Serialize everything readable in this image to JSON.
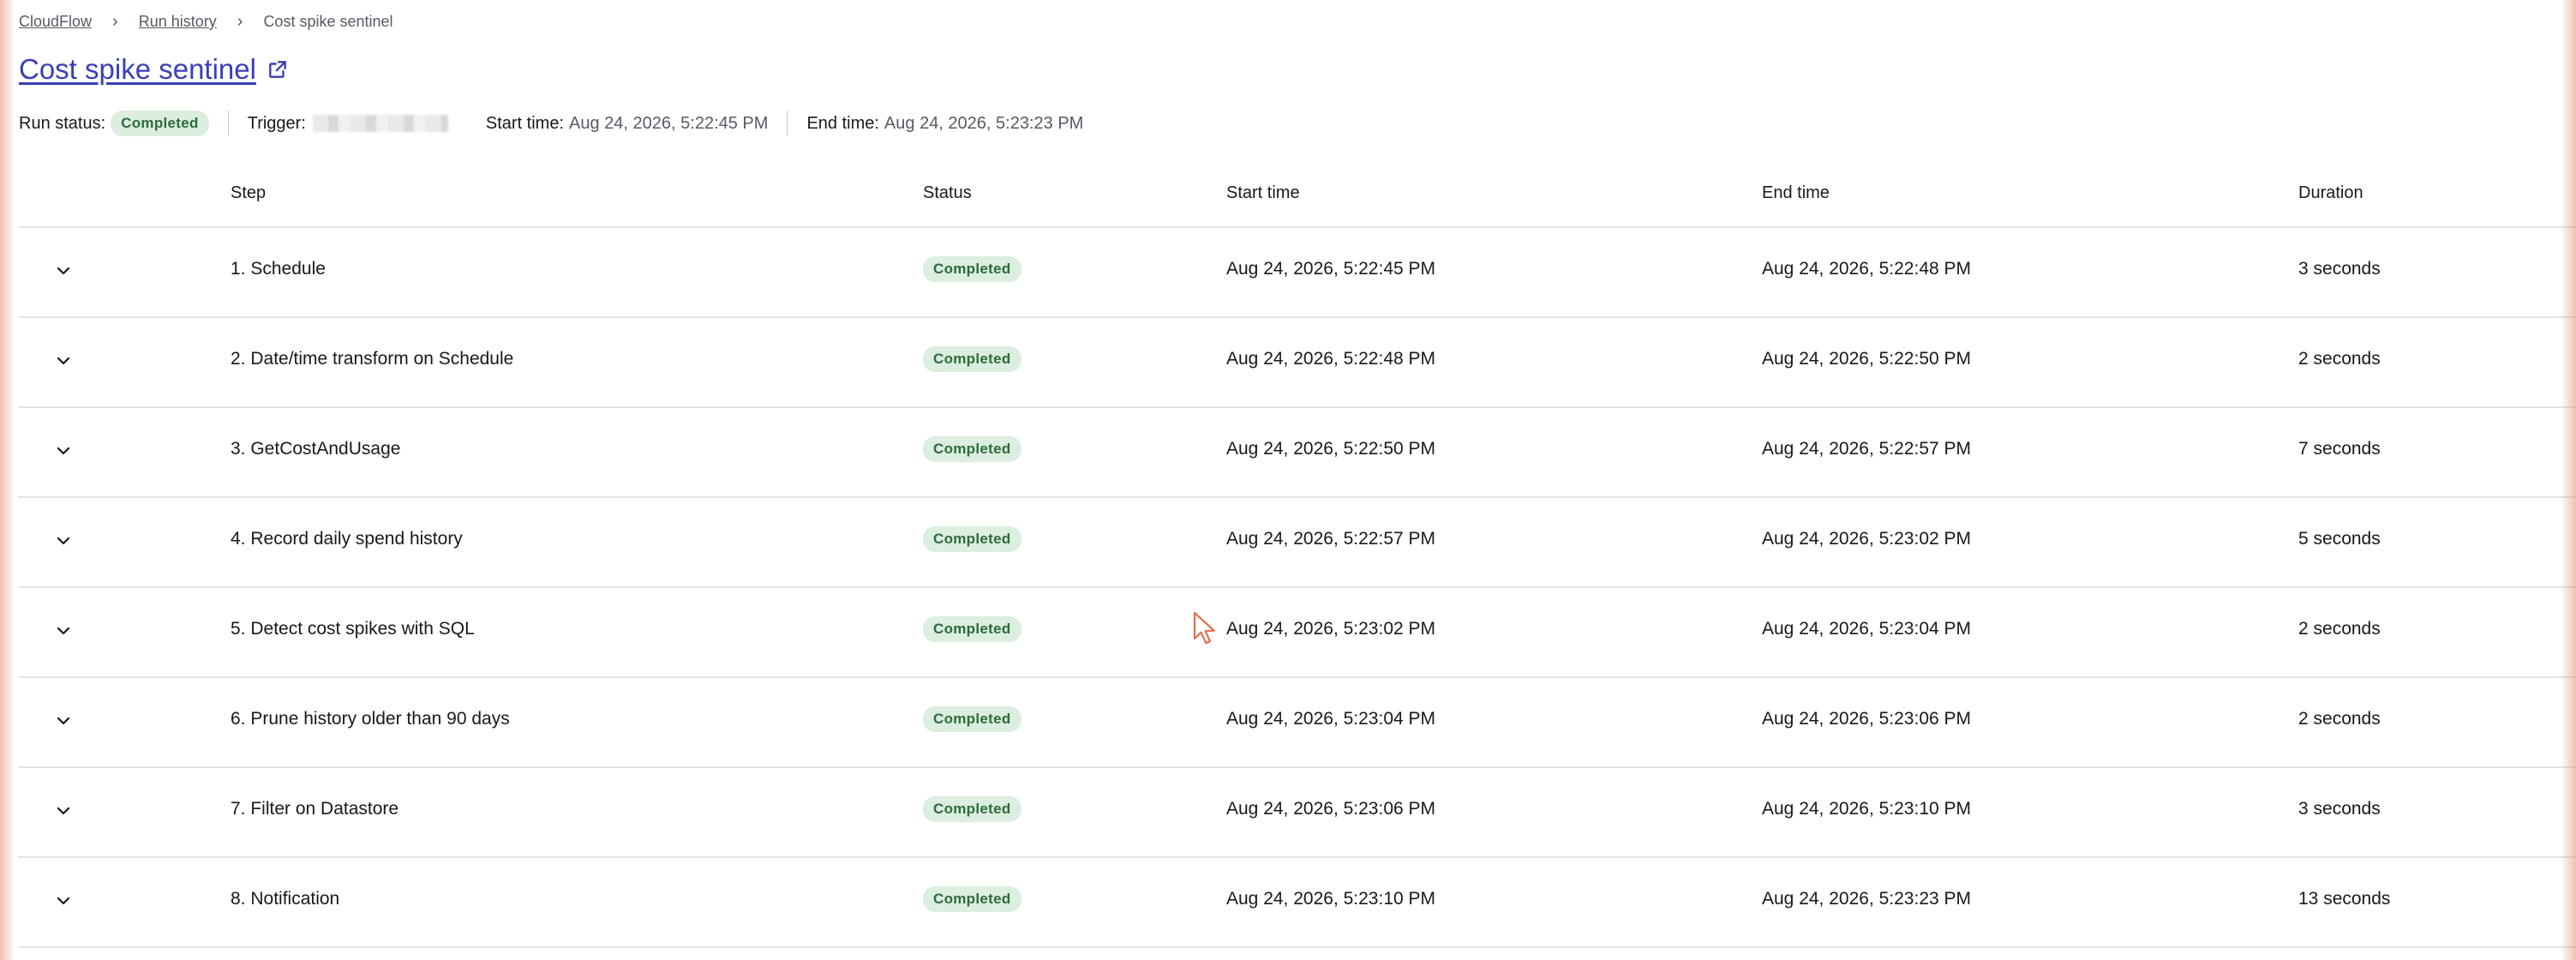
{
  "breadcrumb": {
    "items": [
      "CloudFlow",
      "Run history",
      "Cost spike sentinel"
    ]
  },
  "title": "Cost spike sentinel",
  "meta": {
    "run_status_label": "Run status:",
    "run_status_value": "Completed",
    "trigger_label": "Trigger:",
    "start_time_label": "Start time:",
    "start_time_value": "Aug 24, 2026, 5:22:45 PM",
    "end_time_label": "End time:",
    "end_time_value": "Aug 24, 2026, 5:23:23 PM"
  },
  "table": {
    "headers": {
      "step": "Step",
      "status": "Status",
      "start": "Start time",
      "end": "End time",
      "duration": "Duration"
    },
    "rows": [
      {
        "step": "1. Schedule",
        "status": "Completed",
        "start": "Aug 24, 2026, 5:22:45 PM",
        "end": "Aug 24, 2026, 5:22:48 PM",
        "duration": "3 seconds"
      },
      {
        "step": "2. Date/time transform on Schedule",
        "status": "Completed",
        "start": "Aug 24, 2026, 5:22:48 PM",
        "end": "Aug 24, 2026, 5:22:50 PM",
        "duration": "2 seconds"
      },
      {
        "step": "3. GetCostAndUsage",
        "status": "Completed",
        "start": "Aug 24, 2026, 5:22:50 PM",
        "end": "Aug 24, 2026, 5:22:57 PM",
        "duration": "7 seconds"
      },
      {
        "step": "4. Record daily spend history",
        "status": "Completed",
        "start": "Aug 24, 2026, 5:22:57 PM",
        "end": "Aug 24, 2026, 5:23:02 PM",
        "duration": "5 seconds"
      },
      {
        "step": "5. Detect cost spikes with SQL",
        "status": "Completed",
        "start": "Aug 24, 2026, 5:23:02 PM",
        "end": "Aug 24, 2026, 5:23:04 PM",
        "duration": "2 seconds"
      },
      {
        "step": "6. Prune history older than 90 days",
        "status": "Completed",
        "start": "Aug 24, 2026, 5:23:04 PM",
        "end": "Aug 24, 2026, 5:23:06 PM",
        "duration": "2 seconds"
      },
      {
        "step": "7. Filter on Datastore",
        "status": "Completed",
        "start": "Aug 24, 2026, 5:23:06 PM",
        "end": "Aug 24, 2026, 5:23:10 PM",
        "duration": "3 seconds"
      },
      {
        "step": "8. Notification",
        "status": "Completed",
        "start": "Aug 24, 2026, 5:23:10 PM",
        "end": "Aug 24, 2026, 5:23:23 PM",
        "duration": "13 seconds"
      }
    ]
  },
  "icons": {
    "title_link": "external-link-icon",
    "row_expand": "chevron-down-icon",
    "breadcrumb_separator": "chevron-right-icon",
    "pointer": "mouse-cursor-icon"
  },
  "colors": {
    "title_link": "#3a3fb8",
    "badge_bg": "#dbeee0",
    "badge_text": "#2e6b3b",
    "divider": "#e3e4e6"
  }
}
